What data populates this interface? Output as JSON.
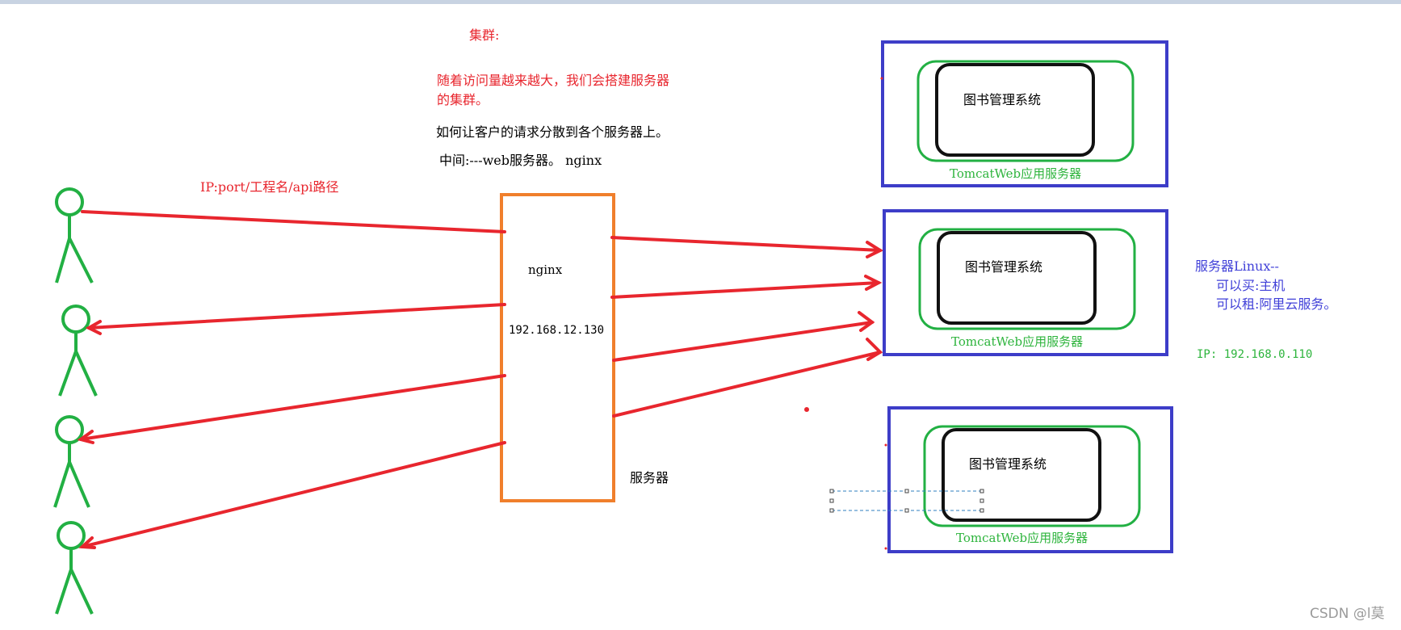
{
  "notes": {
    "cluster_title": "集群:",
    "cluster_desc_line1": "随着访问量越来越大，我们会搭建服务器",
    "cluster_desc_line2": "的集群。",
    "question": "如何让客户的请求分散到各个服务器上。",
    "middle": "中间:---web服务器。 nginx"
  },
  "request_path": "IP:port/工程名/api路径",
  "nginx": {
    "name": "nginx",
    "ip": "192.168.12.130",
    "caption": "服务器"
  },
  "servers": [
    {
      "app": "图书管理系统",
      "container": "TomcatWeb应用服务器"
    },
    {
      "app": "图书管理系统",
      "container": "TomcatWeb应用服务器"
    },
    {
      "app": "图书管理系统",
      "container": "TomcatWeb应用服务器"
    }
  ],
  "server_info": {
    "title": "服务器Linux--",
    "buy": "可以买:主机",
    "rent": "可以租:阿里云服务。",
    "ip": "IP: 192.168.0.110"
  },
  "watermark": "CSDN @l莫",
  "colors": {
    "arrow": "#e8262e",
    "user": "#22b043",
    "nginx_box": "#f07f2c",
    "server_outer": "#3d3dc8",
    "tomcat": "#22b043",
    "app": "#111111"
  }
}
